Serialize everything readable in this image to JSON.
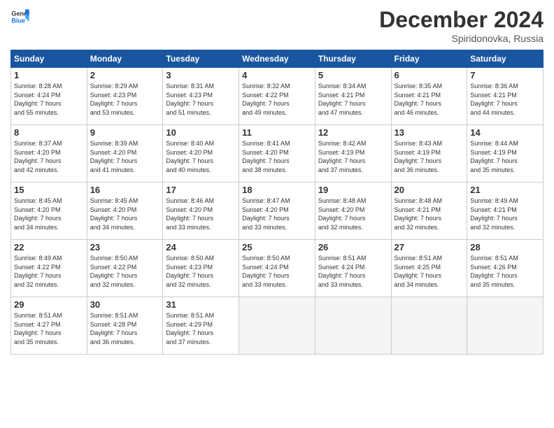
{
  "header": {
    "logo_line1": "General",
    "logo_line2": "Blue",
    "month": "December 2024",
    "location": "Spiridonovka, Russia"
  },
  "days_of_week": [
    "Sunday",
    "Monday",
    "Tuesday",
    "Wednesday",
    "Thursday",
    "Friday",
    "Saturday"
  ],
  "weeks": [
    [
      {
        "day": 1,
        "info": "Sunrise: 8:28 AM\nSunset: 4:24 PM\nDaylight: 7 hours\nand 55 minutes."
      },
      {
        "day": 2,
        "info": "Sunrise: 8:29 AM\nSunset: 4:23 PM\nDaylight: 7 hours\nand 53 minutes."
      },
      {
        "day": 3,
        "info": "Sunrise: 8:31 AM\nSunset: 4:23 PM\nDaylight: 7 hours\nand 51 minutes."
      },
      {
        "day": 4,
        "info": "Sunrise: 8:32 AM\nSunset: 4:22 PM\nDaylight: 7 hours\nand 49 minutes."
      },
      {
        "day": 5,
        "info": "Sunrise: 8:34 AM\nSunset: 4:21 PM\nDaylight: 7 hours\nand 47 minutes."
      },
      {
        "day": 6,
        "info": "Sunrise: 8:35 AM\nSunset: 4:21 PM\nDaylight: 7 hours\nand 46 minutes."
      },
      {
        "day": 7,
        "info": "Sunrise: 8:36 AM\nSunset: 4:21 PM\nDaylight: 7 hours\nand 44 minutes."
      }
    ],
    [
      {
        "day": 8,
        "info": "Sunrise: 8:37 AM\nSunset: 4:20 PM\nDaylight: 7 hours\nand 42 minutes."
      },
      {
        "day": 9,
        "info": "Sunrise: 8:39 AM\nSunset: 4:20 PM\nDaylight: 7 hours\nand 41 minutes."
      },
      {
        "day": 10,
        "info": "Sunrise: 8:40 AM\nSunset: 4:20 PM\nDaylight: 7 hours\nand 40 minutes."
      },
      {
        "day": 11,
        "info": "Sunrise: 8:41 AM\nSunset: 4:20 PM\nDaylight: 7 hours\nand 38 minutes."
      },
      {
        "day": 12,
        "info": "Sunrise: 8:42 AM\nSunset: 4:19 PM\nDaylight: 7 hours\nand 37 minutes."
      },
      {
        "day": 13,
        "info": "Sunrise: 8:43 AM\nSunset: 4:19 PM\nDaylight: 7 hours\nand 36 minutes."
      },
      {
        "day": 14,
        "info": "Sunrise: 8:44 AM\nSunset: 4:19 PM\nDaylight: 7 hours\nand 35 minutes."
      }
    ],
    [
      {
        "day": 15,
        "info": "Sunrise: 8:45 AM\nSunset: 4:20 PM\nDaylight: 7 hours\nand 34 minutes."
      },
      {
        "day": 16,
        "info": "Sunrise: 8:45 AM\nSunset: 4:20 PM\nDaylight: 7 hours\nand 34 minutes."
      },
      {
        "day": 17,
        "info": "Sunrise: 8:46 AM\nSunset: 4:20 PM\nDaylight: 7 hours\nand 33 minutes."
      },
      {
        "day": 18,
        "info": "Sunrise: 8:47 AM\nSunset: 4:20 PM\nDaylight: 7 hours\nand 33 minutes."
      },
      {
        "day": 19,
        "info": "Sunrise: 8:48 AM\nSunset: 4:20 PM\nDaylight: 7 hours\nand 32 minutes."
      },
      {
        "day": 20,
        "info": "Sunrise: 8:48 AM\nSunset: 4:21 PM\nDaylight: 7 hours\nand 32 minutes."
      },
      {
        "day": 21,
        "info": "Sunrise: 8:49 AM\nSunset: 4:21 PM\nDaylight: 7 hours\nand 32 minutes."
      }
    ],
    [
      {
        "day": 22,
        "info": "Sunrise: 8:49 AM\nSunset: 4:22 PM\nDaylight: 7 hours\nand 32 minutes."
      },
      {
        "day": 23,
        "info": "Sunrise: 8:50 AM\nSunset: 4:22 PM\nDaylight: 7 hours\nand 32 minutes."
      },
      {
        "day": 24,
        "info": "Sunrise: 8:50 AM\nSunset: 4:23 PM\nDaylight: 7 hours\nand 32 minutes."
      },
      {
        "day": 25,
        "info": "Sunrise: 8:50 AM\nSunset: 4:24 PM\nDaylight: 7 hours\nand 33 minutes."
      },
      {
        "day": 26,
        "info": "Sunrise: 8:51 AM\nSunset: 4:24 PM\nDaylight: 7 hours\nand 33 minutes."
      },
      {
        "day": 27,
        "info": "Sunrise: 8:51 AM\nSunset: 4:25 PM\nDaylight: 7 hours\nand 34 minutes."
      },
      {
        "day": 28,
        "info": "Sunrise: 8:51 AM\nSunset: 4:26 PM\nDaylight: 7 hours\nand 35 minutes."
      }
    ],
    [
      {
        "day": 29,
        "info": "Sunrise: 8:51 AM\nSunset: 4:27 PM\nDaylight: 7 hours\nand 35 minutes."
      },
      {
        "day": 30,
        "info": "Sunrise: 8:51 AM\nSunset: 4:28 PM\nDaylight: 7 hours\nand 36 minutes."
      },
      {
        "day": 31,
        "info": "Sunrise: 8:51 AM\nSunset: 4:29 PM\nDaylight: 7 hours\nand 37 minutes."
      },
      null,
      null,
      null,
      null
    ]
  ]
}
